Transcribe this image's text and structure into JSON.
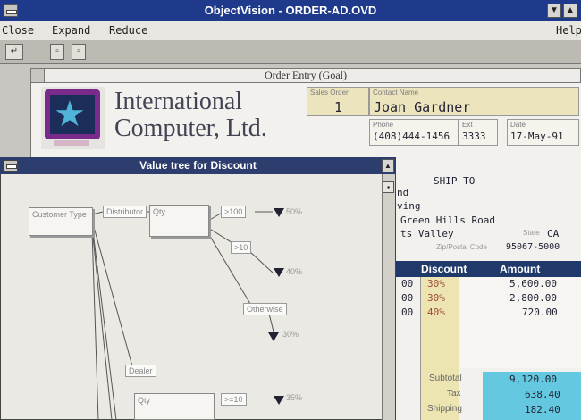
{
  "window": {
    "title": "ObjectVision - ORDER-AD.OVD"
  },
  "menu": {
    "close": "Close",
    "expand": "Expand",
    "reduce": "Reduce",
    "help": "Help"
  },
  "form": {
    "title": "Order Entry (Goal)",
    "company_line1": "International",
    "company_line2": "Computer, Ltd.",
    "sales_order": {
      "label": "Sales Order",
      "value": "1"
    },
    "contact": {
      "label": "Contact Name",
      "value": "Joan Gardner"
    },
    "phone": {
      "label": "Phone",
      "value": "(408)444-1456"
    },
    "ext": {
      "label": "Ext",
      "value": "3333"
    },
    "date": {
      "label": "Date",
      "value": "17-May-91"
    }
  },
  "ship_to": {
    "heading": "SHIP TO",
    "line1": "nd",
    "line2": "ving",
    "line3": "Green Hills Road",
    "city": "ts Valley",
    "state_label": "State",
    "state": "CA",
    "zip_label": "Zip/Postal Code",
    "zip": "95067-5000"
  },
  "grid": {
    "headers": [
      "Discount",
      "Amount"
    ],
    "rows": [
      {
        "left": "00",
        "discount": "30%",
        "amount": "5,600.00"
      },
      {
        "left": "00",
        "discount": "30%",
        "amount": "2,800.00"
      },
      {
        "left": "00",
        "discount": "40%",
        "amount": "720.00"
      }
    ],
    "subtotal_label": "Subtotal",
    "subtotal": "9,120.00",
    "tax_label": "Tax",
    "tax": "638.40",
    "shipping_label": "Shipping",
    "shipping": "182.40"
  },
  "value_tree": {
    "title": "Value tree for Discount",
    "nodes": {
      "customer_type": "Customer Type",
      "distributor": "Distributor",
      "qty": "Qty",
      "qty2": "Qty",
      "dealer": "Dealer",
      "gt100": ">100",
      "gt10": ">10",
      "otherwise": "Otherwise",
      "gt10b": ">=10"
    },
    "pcts": [
      "50%",
      "40%",
      "30%",
      "35%"
    ]
  }
}
